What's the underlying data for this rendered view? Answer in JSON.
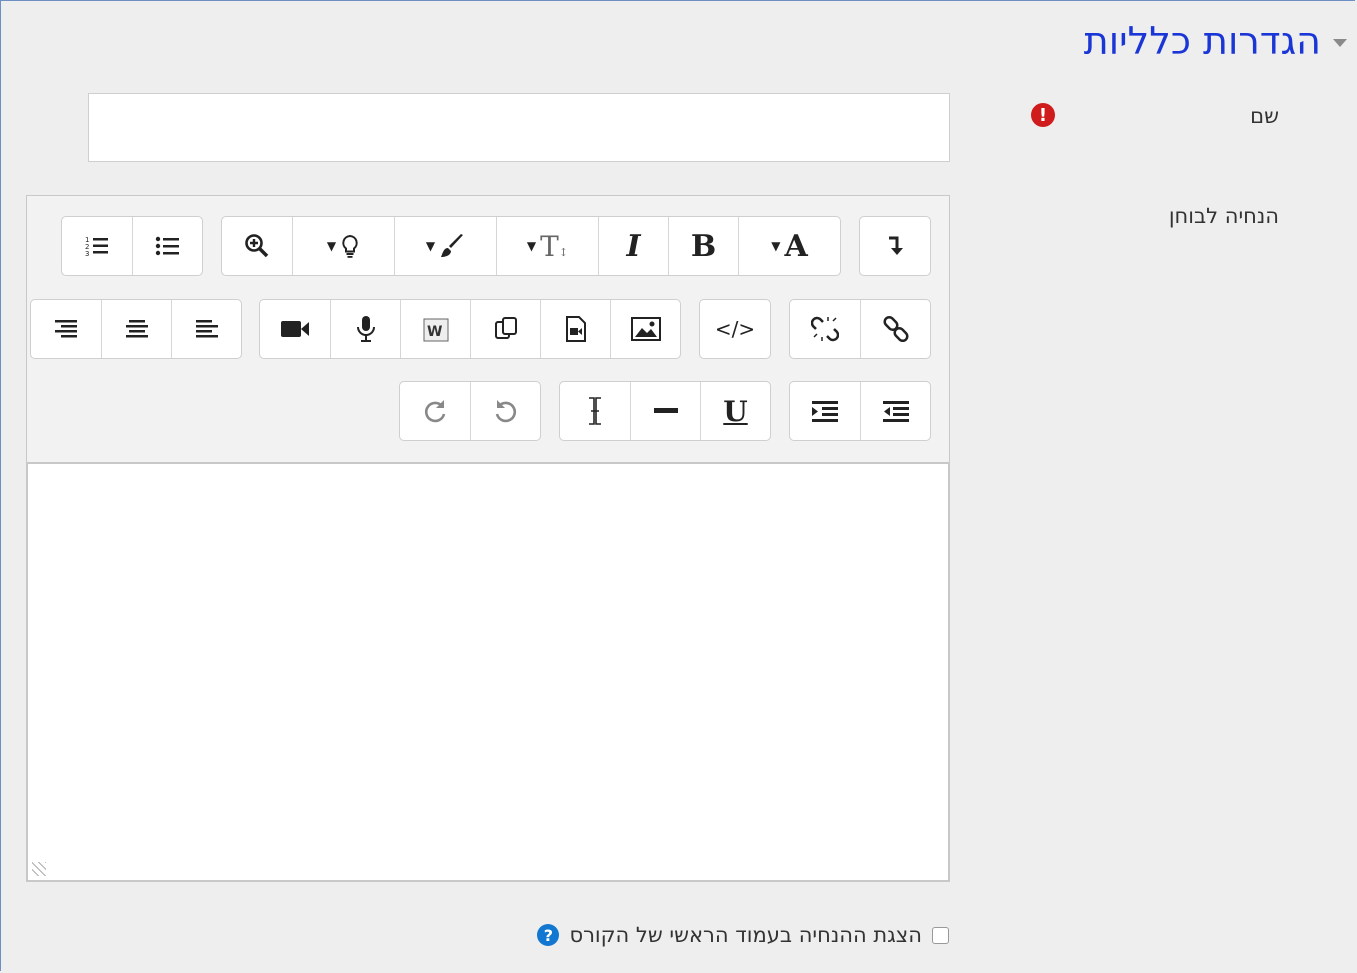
{
  "section": {
    "title": "הגדרות כלליות"
  },
  "fields": {
    "name_label": "שם",
    "intro_label": "הנחיה לבוחן",
    "required_mark": "!"
  },
  "show_on_course_page": {
    "label": "הצגת ההנחיה בעמוד הראשי של הקורס",
    "help_mark": "?",
    "checked": false
  },
  "toolbar": {
    "row1": {
      "lists": [
        "numbered-list",
        "bullet-list"
      ],
      "formatting": [
        {
          "name": "zoom",
          "glyph": "⊕"
        },
        {
          "name": "accessibility",
          "glyph": "▾💡"
        },
        {
          "name": "highlight",
          "glyph": "▾🖌"
        },
        {
          "name": "font-size",
          "glyph": "▾T"
        },
        {
          "name": "italic",
          "glyph": "I"
        },
        {
          "name": "bold",
          "glyph": "B"
        },
        {
          "name": "font-color",
          "glyph": "▾A"
        }
      ],
      "toggle": "↴"
    },
    "row2": {
      "align": [
        "align-right",
        "align-center",
        "align-left"
      ],
      "media": [
        "video",
        "microphone",
        "word",
        "paste",
        "media",
        "image"
      ],
      "html": "</>",
      "links": [
        "unlink",
        "link"
      ]
    },
    "row3": {
      "history": [
        "redo",
        "undo"
      ],
      "text": [
        "clear-format",
        "horizontal-rule",
        "underline"
      ],
      "underline_glyph": "U",
      "indent": [
        "indent",
        "outdent"
      ]
    }
  }
}
